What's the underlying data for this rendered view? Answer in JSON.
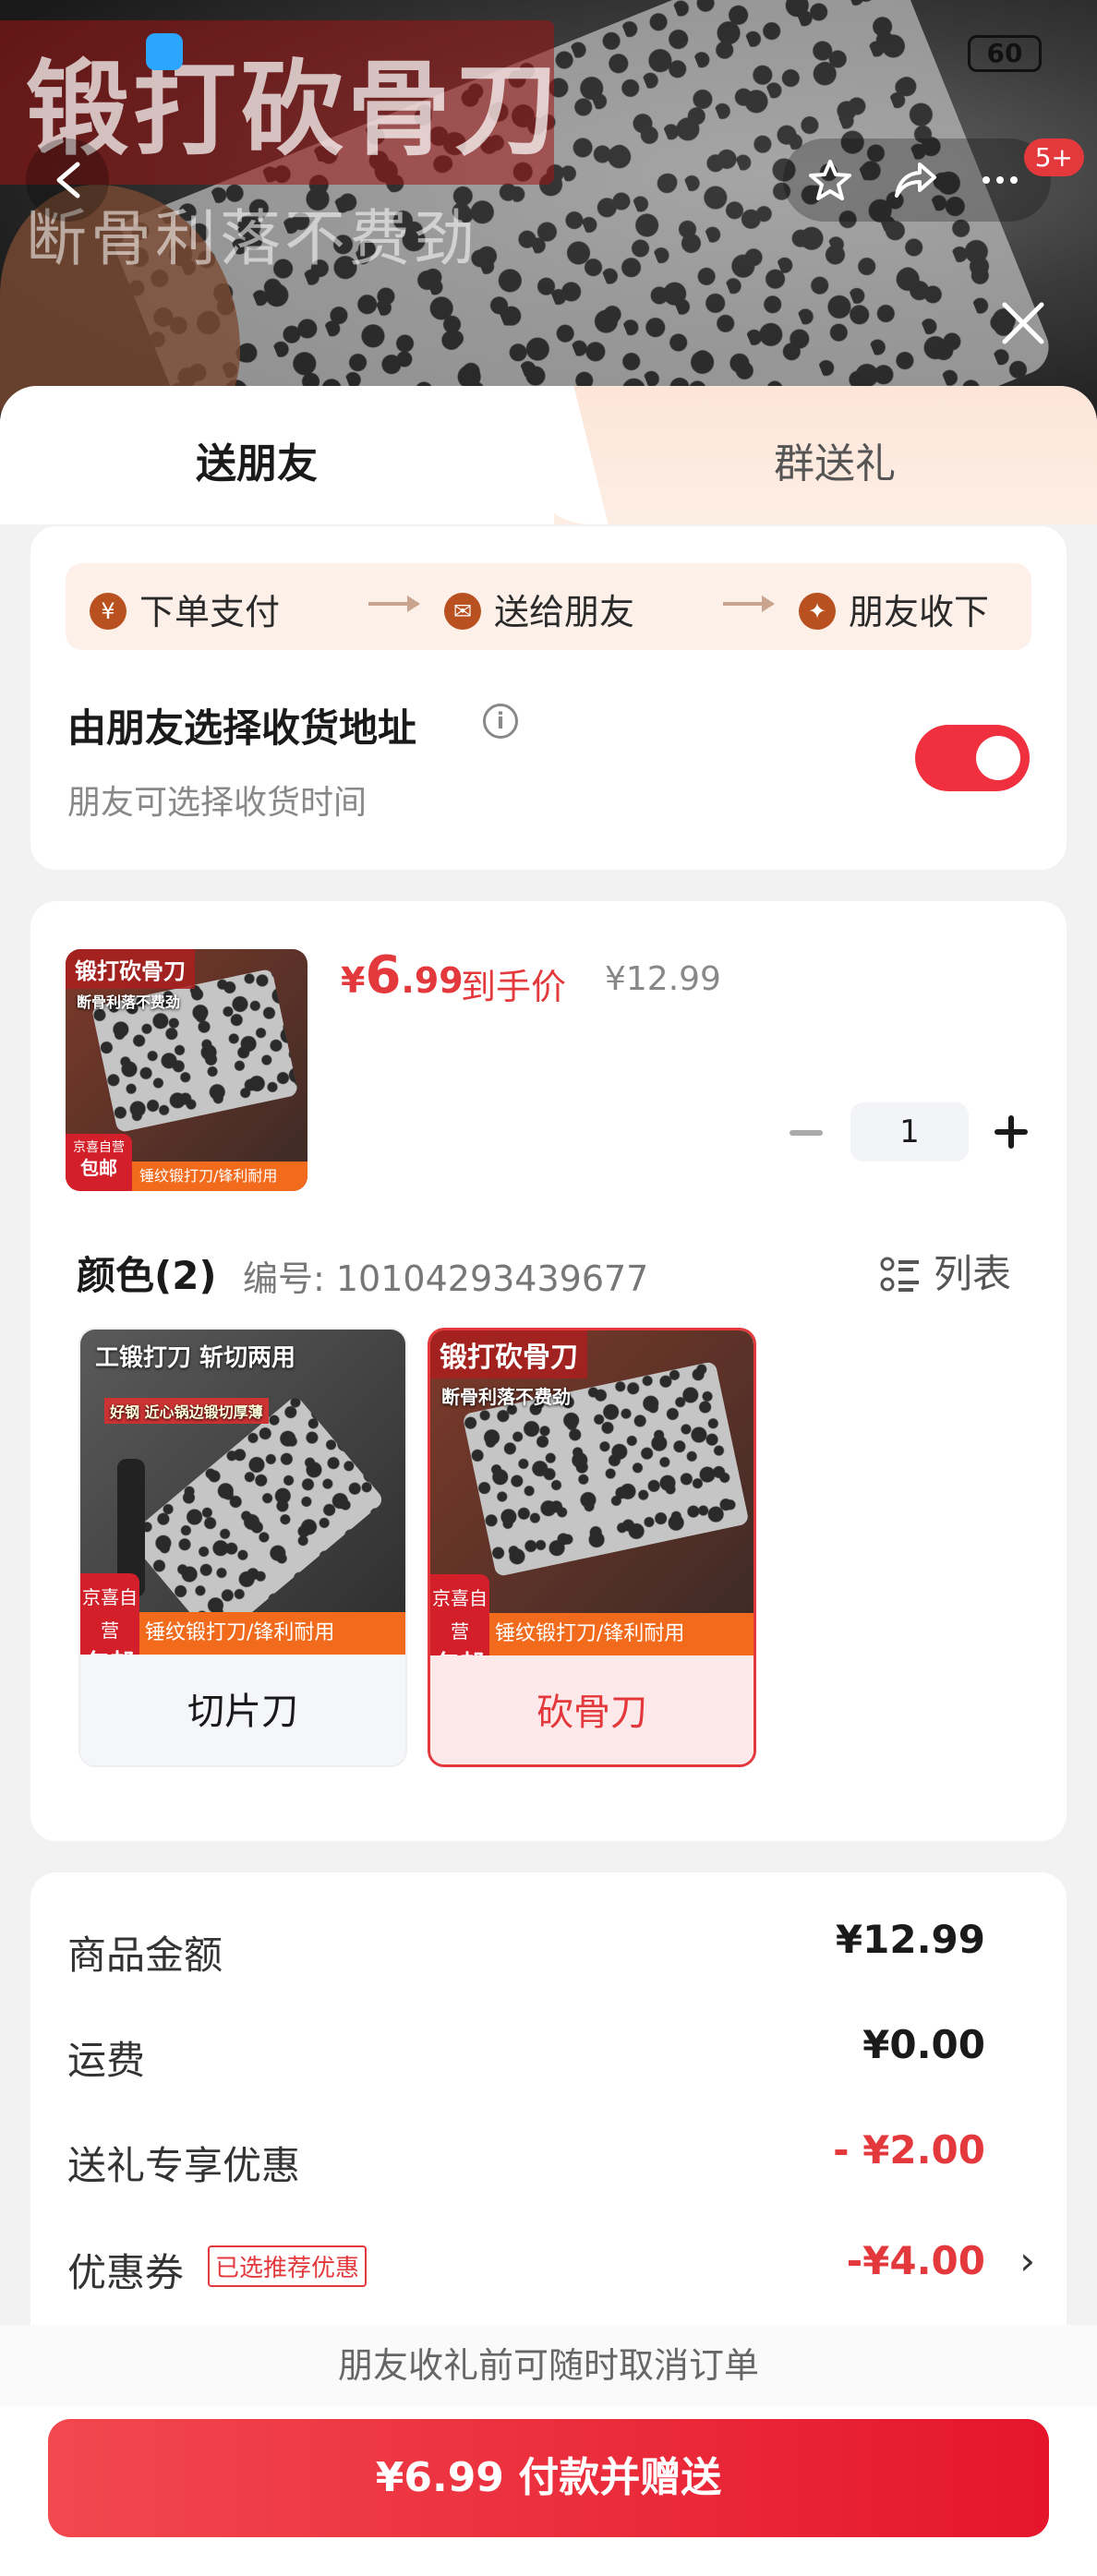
{
  "status_bar": {
    "time": "",
    "battery": "60"
  },
  "hero": {
    "title": "锻打砍骨刀",
    "subtitle": "断骨利落不费劲",
    "badge": "5+"
  },
  "tabs": {
    "send_friend": "送朋友",
    "group_gift": "群送礼"
  },
  "steps": [
    {
      "icon": "yen-icon",
      "label": "下单支付"
    },
    {
      "icon": "wechat-icon",
      "label": "送给朋友"
    },
    {
      "icon": "gift-icon",
      "label": "朋友收下"
    }
  ],
  "address": {
    "title": "由朋友选择收货地址",
    "subtitle": "朋友可选择收货时间",
    "toggle_on": true
  },
  "product": {
    "thumb_caption": "锻打砍骨刀",
    "thumb_sub": "断骨利落不费劲",
    "price_symbol": "¥",
    "price_int": "6",
    "price_dec": ".99",
    "price_tag": "到手价",
    "price_original": "¥12.99",
    "quantity": "1"
  },
  "variants": {
    "title": "颜色(2)",
    "code": "编号: 10104293439677",
    "list_label": "列表",
    "items": [
      {
        "label": "切片刀",
        "caption": "工锻打刀 斩切两用",
        "sub": "好钢 近心锅边锻切厚薄",
        "banner": "锤纹锻打刀/锋利耐用",
        "jd": "京喜自营",
        "jd_big": "包邮",
        "selected": false
      },
      {
        "label": "砍骨刀",
        "caption": "锻打砍骨刀",
        "sub": "断骨利落不费劲",
        "banner": "锤纹锻打刀/锋利耐用",
        "jd": "京喜自营",
        "jd_big": "包邮",
        "selected": true
      }
    ]
  },
  "summary": {
    "goods_label": "商品金额",
    "goods_value": "¥12.99",
    "shipping_label": "运费",
    "shipping_value": "¥0.00",
    "gift_discount_label": "送礼专享优惠",
    "gift_discount_value": "- ¥2.00",
    "coupon_label": "优惠券",
    "coupon_tag": "已选推荐优惠",
    "coupon_value": "-¥4.00"
  },
  "cancel_note": "朋友收礼前可随时取消订单",
  "pay_button": "¥6.99 付款并赠送",
  "colors": {
    "accent": "#e4393c",
    "step_icon": "#b8501f"
  }
}
